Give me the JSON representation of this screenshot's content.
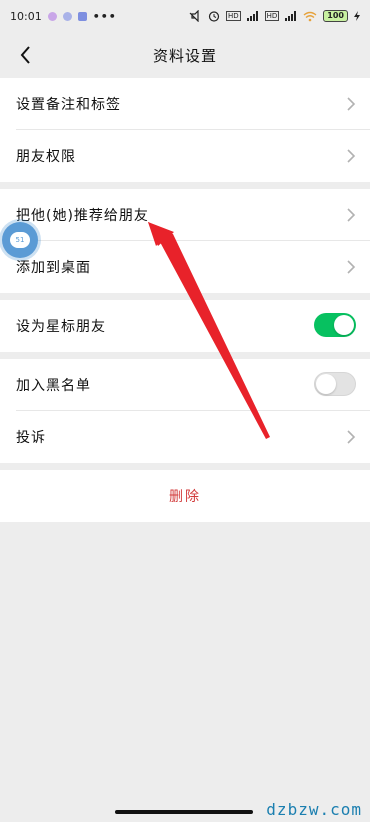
{
  "status_bar": {
    "time": "10:01",
    "overflow": "•••",
    "net_tag_1": "HD",
    "net_tag_2": "HD",
    "battery": "100"
  },
  "header": {
    "title": "资料设置",
    "back_icon": "chevron-left-icon"
  },
  "groups": {
    "g1": {
      "remark_label": "设置备注和标签",
      "permission_label": "朋友权限"
    },
    "g2": {
      "recommend_label": "把他(她)推荐给朋友",
      "desktop_label": "添加到桌面"
    },
    "g3": {
      "star_label": "设为星标朋友",
      "star_on": true
    },
    "g4": {
      "blacklist_label": "加入黑名单",
      "blacklist_on": false,
      "report_label": "投诉"
    },
    "g5": {
      "delete_label": "删除"
    }
  },
  "floating_bubble": {
    "text": "51"
  },
  "watermark": "dzbzw.com",
  "colors": {
    "accent_green": "#07c160",
    "delete_red": "#d23b3b",
    "annotation_red": "#e8222a",
    "background": "#ededed"
  }
}
